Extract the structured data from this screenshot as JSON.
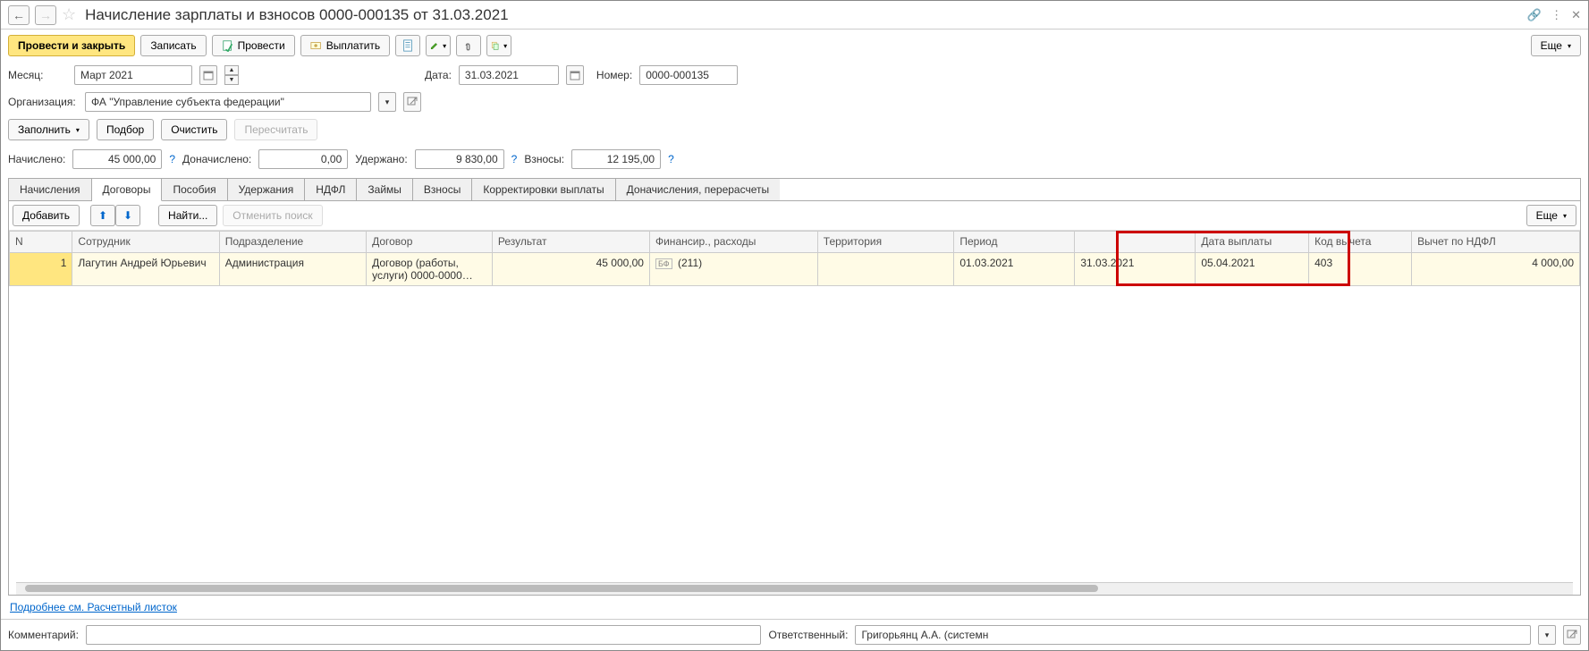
{
  "header": {
    "title": "Начисление зарплаты и взносов 0000-000135 от 31.03.2021"
  },
  "toolbar": {
    "post_close": "Провести и закрыть",
    "save": "Записать",
    "post": "Провести",
    "pay": "Выплатить",
    "more": "Еще"
  },
  "fields": {
    "month_label": "Месяц:",
    "month_value": "Март 2021",
    "date_label": "Дата:",
    "date_value": "31.03.2021",
    "number_label": "Номер:",
    "number_value": "0000-000135",
    "org_label": "Организация:",
    "org_value": "ФА \"Управление субъекта федерации\""
  },
  "action_row": {
    "fill": "Заполнить",
    "pick": "Подбор",
    "clear": "Очистить",
    "recalc": "Пересчитать"
  },
  "totals": {
    "accrued_label": "Начислено:",
    "accrued_value": "45 000,00",
    "addl_label": "Доначислено:",
    "addl_value": "0,00",
    "withheld_label": "Удержано:",
    "withheld_value": "9 830,00",
    "contrib_label": "Взносы:",
    "contrib_value": "12 195,00"
  },
  "tabs": [
    "Начисления",
    "Договоры",
    "Пособия",
    "Удержания",
    "НДФЛ",
    "Займы",
    "Взносы",
    "Корректировки выплаты",
    "Доначисления, перерасчеты"
  ],
  "table_toolbar": {
    "add": "Добавить",
    "find": "Найти...",
    "cancel_search": "Отменить поиск",
    "more": "Еще"
  },
  "table": {
    "columns": [
      "N",
      "Сотрудник",
      "Подразделение",
      "Договор",
      "Результат",
      "Финансир., расходы",
      "Территория",
      "Период",
      "",
      "Дата выплаты",
      "Код вычета",
      "Вычет по НДФЛ"
    ],
    "row": {
      "n": "1",
      "employee": "Лагутин Андрей Юрьевич",
      "dept": "Администрация",
      "contract": "Договор (работы, услуги) 0000-0000…",
      "result": "45 000,00",
      "finance_icon": "БФ",
      "finance": "(211)",
      "territory": "",
      "period_from": "01.03.2021",
      "period_to": "31.03.2021",
      "pay_date": "05.04.2021",
      "deduct_code": "403",
      "deduct_ndfl": "4 000,00"
    }
  },
  "link": "Подробнее см. Расчетный листок",
  "footer": {
    "comment_label": "Комментарий:",
    "resp_label": "Ответственный:",
    "resp_value": "Григорьянц А.А. (системн"
  }
}
